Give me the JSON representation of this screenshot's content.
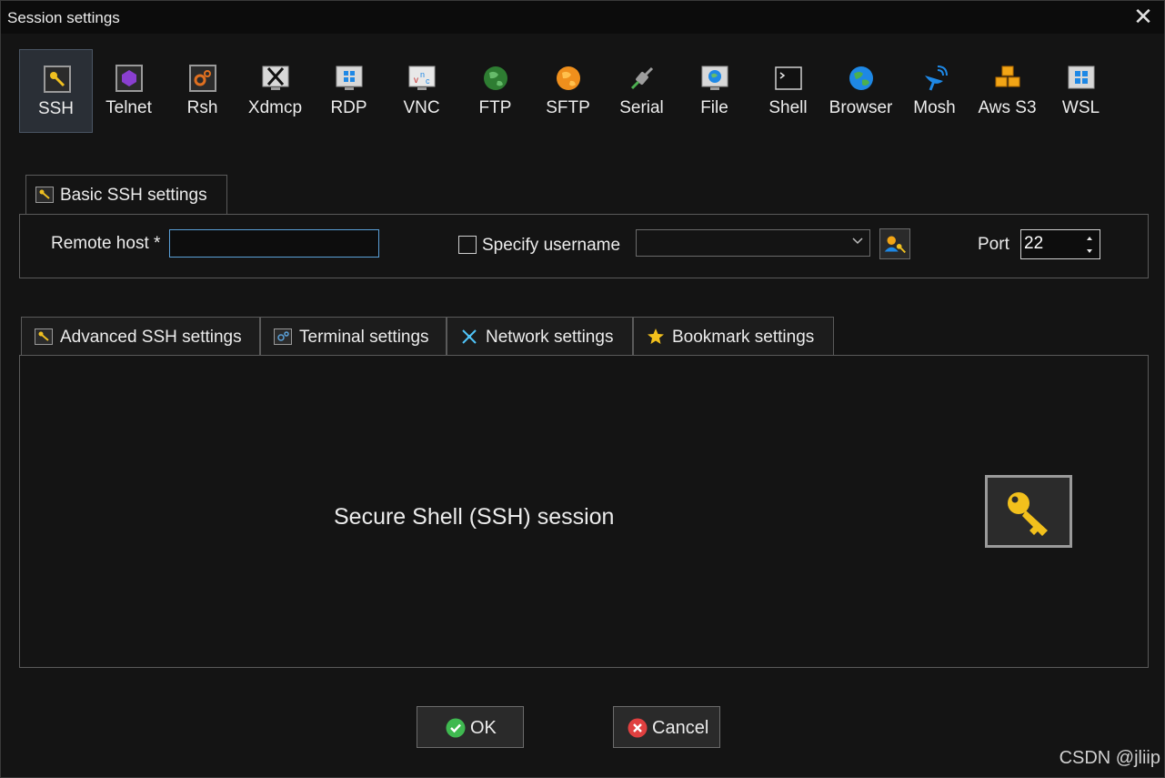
{
  "window": {
    "title": "Session settings"
  },
  "session_types": [
    {
      "label": "SSH",
      "icon": "key-icon",
      "selected": true
    },
    {
      "label": "Telnet",
      "icon": "telnet-icon"
    },
    {
      "label": "Rsh",
      "icon": "rsh-icon"
    },
    {
      "label": "Xdmcp",
      "icon": "x-display-icon"
    },
    {
      "label": "RDP",
      "icon": "windows-monitor-icon"
    },
    {
      "label": "VNC",
      "icon": "vnc-monitor-icon"
    },
    {
      "label": "FTP",
      "icon": "green-globe-icon"
    },
    {
      "label": "SFTP",
      "icon": "orange-globe-icon"
    },
    {
      "label": "Serial",
      "icon": "serial-plug-icon"
    },
    {
      "label": "File",
      "icon": "file-monitor-icon"
    },
    {
      "label": "Shell",
      "icon": "terminal-icon"
    },
    {
      "label": "Browser",
      "icon": "browser-globe-icon"
    },
    {
      "label": "Mosh",
      "icon": "satellite-dish-icon"
    },
    {
      "label": "Aws S3",
      "icon": "aws-cubes-icon"
    },
    {
      "label": "WSL",
      "icon": "windows-logo-icon"
    }
  ],
  "basic": {
    "tab_label": "Basic SSH settings",
    "remote_host_label": "Remote host *",
    "remote_host_value": "",
    "specify_username_label": "Specify username",
    "specify_username_checked": false,
    "username_value": "",
    "port_label": "Port",
    "port_value": "22"
  },
  "tabs": [
    {
      "label": "Advanced SSH settings",
      "icon": "key-icon"
    },
    {
      "label": "Terminal settings",
      "icon": "terminal-settings-icon"
    },
    {
      "label": "Network settings",
      "icon": "network-icon"
    },
    {
      "label": "Bookmark settings",
      "icon": "star-icon"
    }
  ],
  "description": "Secure Shell (SSH) session",
  "buttons": {
    "ok": "OK",
    "cancel": "Cancel"
  },
  "watermark": "CSDN @jliip",
  "colors": {
    "background": "#141414",
    "selected_tab_bg": "#2a2f36",
    "ok_green": "#3fb950",
    "cancel_red": "#e04040",
    "accent_blue": "#5aa0d8"
  }
}
